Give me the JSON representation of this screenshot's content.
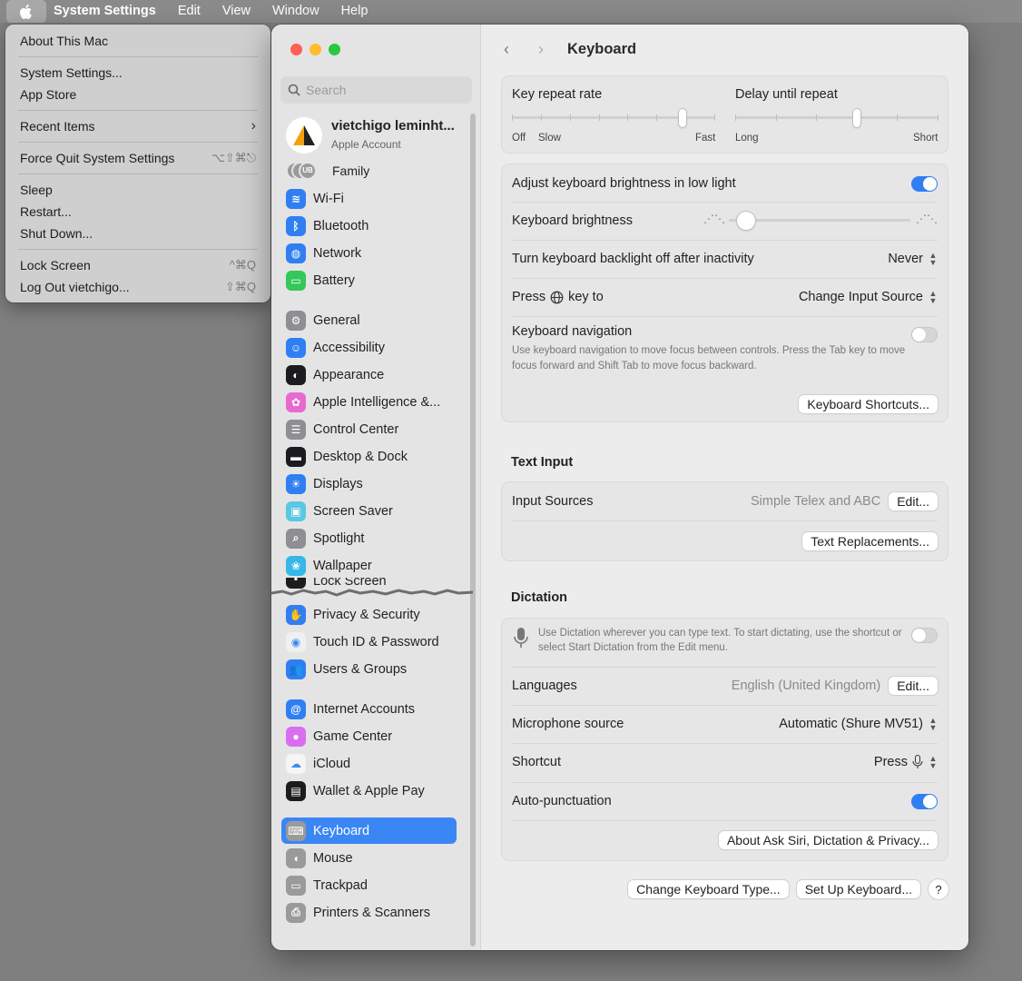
{
  "menubar": {
    "app_name": "System Settings",
    "items": [
      "Edit",
      "View",
      "Window",
      "Help"
    ]
  },
  "apple_menu": {
    "about": "About This Mac",
    "system_settings": "System Settings...",
    "app_store": "App Store",
    "recent_items": "Recent Items",
    "force_quit": "Force Quit System Settings",
    "force_quit_shortcut": "⌥⇧⌘⎋",
    "sleep": "Sleep",
    "restart": "Restart...",
    "shut_down": "Shut Down...",
    "lock_screen": "Lock Screen",
    "lock_screen_shortcut": "^⌘Q",
    "log_out": "Log Out vietchigo...",
    "log_out_shortcut": "⇧⌘Q"
  },
  "sidebar": {
    "search_placeholder": "Search",
    "account_name": "vietchigo leminht...",
    "account_sub": "Apple Account",
    "family_initials": "UB",
    "family": "Family",
    "items": [
      {
        "label": "Wi-Fi",
        "color": "#2f7ff2",
        "glyph": "≋"
      },
      {
        "label": "Bluetooth",
        "color": "#2f7ff2",
        "glyph": "ᛒ"
      },
      {
        "label": "Network",
        "color": "#2f7ff2",
        "glyph": "◍"
      },
      {
        "label": "Battery",
        "color": "#34c759",
        "glyph": "▭"
      },
      {
        "label": "General",
        "color": "#8e8e93",
        "glyph": "⚙"
      },
      {
        "label": "Accessibility",
        "color": "#2f7ff2",
        "glyph": "☺"
      },
      {
        "label": "Appearance",
        "color": "#1c1c1e",
        "glyph": "◐"
      },
      {
        "label": "Apple Intelligence &...",
        "color": "#e86ad0",
        "glyph": "✿"
      },
      {
        "label": "Control Center",
        "color": "#8e8e93",
        "glyph": "☰"
      },
      {
        "label": "Desktop & Dock",
        "color": "#1c1c1e",
        "glyph": "▬"
      },
      {
        "label": "Displays",
        "color": "#2f7ff2",
        "glyph": "☀"
      },
      {
        "label": "Screen Saver",
        "color": "#5ac8e0",
        "glyph": "▣"
      },
      {
        "label": "Spotlight",
        "color": "#8e8e93",
        "glyph": "⌕"
      },
      {
        "label": "Wallpaper",
        "color": "#36b7e8",
        "glyph": "❀"
      },
      {
        "label": "Lock Screen",
        "color": "#1c1c1e",
        "glyph": "▪"
      },
      {
        "label": "Privacy & Security",
        "color": "#2f7ff2",
        "glyph": "✋"
      },
      {
        "label": "Touch ID & Password",
        "color": "#f0f0f0",
        "glyph": "◉"
      },
      {
        "label": "Users & Groups",
        "color": "#2f7ff2",
        "glyph": "👥"
      },
      {
        "label": "Internet Accounts",
        "color": "#2f7ff2",
        "glyph": "@"
      },
      {
        "label": "Game Center",
        "color": "#d96ef0",
        "glyph": "●"
      },
      {
        "label": "iCloud",
        "color": "#f5f5f5",
        "glyph": "☁"
      },
      {
        "label": "Wallet & Apple Pay",
        "color": "#1c1c1e",
        "glyph": "▤"
      },
      {
        "label": "Keyboard",
        "color": "#9a9a9a",
        "glyph": "⌨"
      },
      {
        "label": "Mouse",
        "color": "#9a9a9a",
        "glyph": "◖"
      },
      {
        "label": "Trackpad",
        "color": "#9a9a9a",
        "glyph": "▭"
      },
      {
        "label": "Printers & Scanners",
        "color": "#9a9a9a",
        "glyph": "⎙"
      }
    ],
    "active": "Keyboard"
  },
  "main": {
    "title": "Keyboard",
    "key_repeat_rate": "Key repeat rate",
    "key_repeat_off": "Off",
    "key_repeat_slow": "Slow",
    "key_repeat_fast": "Fast",
    "key_repeat_level": 0.85,
    "delay_until_repeat": "Delay until repeat",
    "delay_long": "Long",
    "delay_short": "Short",
    "delay_level": 0.6,
    "adjust_brightness": "Adjust keyboard brightness in low light",
    "adjust_brightness_on": true,
    "keyboard_brightness": "Keyboard brightness",
    "keyboard_brightness_level": 0.05,
    "backlight_off": "Turn keyboard backlight off after inactivity",
    "backlight_off_value": "Never",
    "press_key_prefix": "Press",
    "press_key_suffix": "key to",
    "press_key_value": "Change Input Source",
    "keyboard_navigation": "Keyboard navigation",
    "keyboard_navigation_desc": "Use keyboard navigation to move focus between controls. Press the Tab key to move focus forward and Shift Tab to move focus backward.",
    "keyboard_navigation_on": false,
    "keyboard_shortcuts_btn": "Keyboard Shortcuts...",
    "text_input_title": "Text Input",
    "input_sources": "Input Sources",
    "input_sources_value": "Simple Telex and ABC",
    "edit_btn": "Edit...",
    "text_replacements_btn": "Text Replacements...",
    "dictation_title": "Dictation",
    "dictation_desc": "Use Dictation wherever you can type text. To start dictating, use the shortcut or select Start Dictation from the Edit menu.",
    "dictation_on": false,
    "languages": "Languages",
    "languages_value": "English (United Kingdom)",
    "languages_edit_btn": "Edit...",
    "microphone_source": "Microphone source",
    "microphone_value": "Automatic (Shure MV51)",
    "shortcut": "Shortcut",
    "shortcut_value": "Press",
    "auto_punctuation": "Auto-punctuation",
    "auto_punctuation_on": true,
    "about_siri_btn": "About Ask Siri, Dictation & Privacy...",
    "change_keyboard_type_btn": "Change Keyboard Type...",
    "set_up_keyboard_btn": "Set Up Keyboard...",
    "help_btn": "?"
  }
}
